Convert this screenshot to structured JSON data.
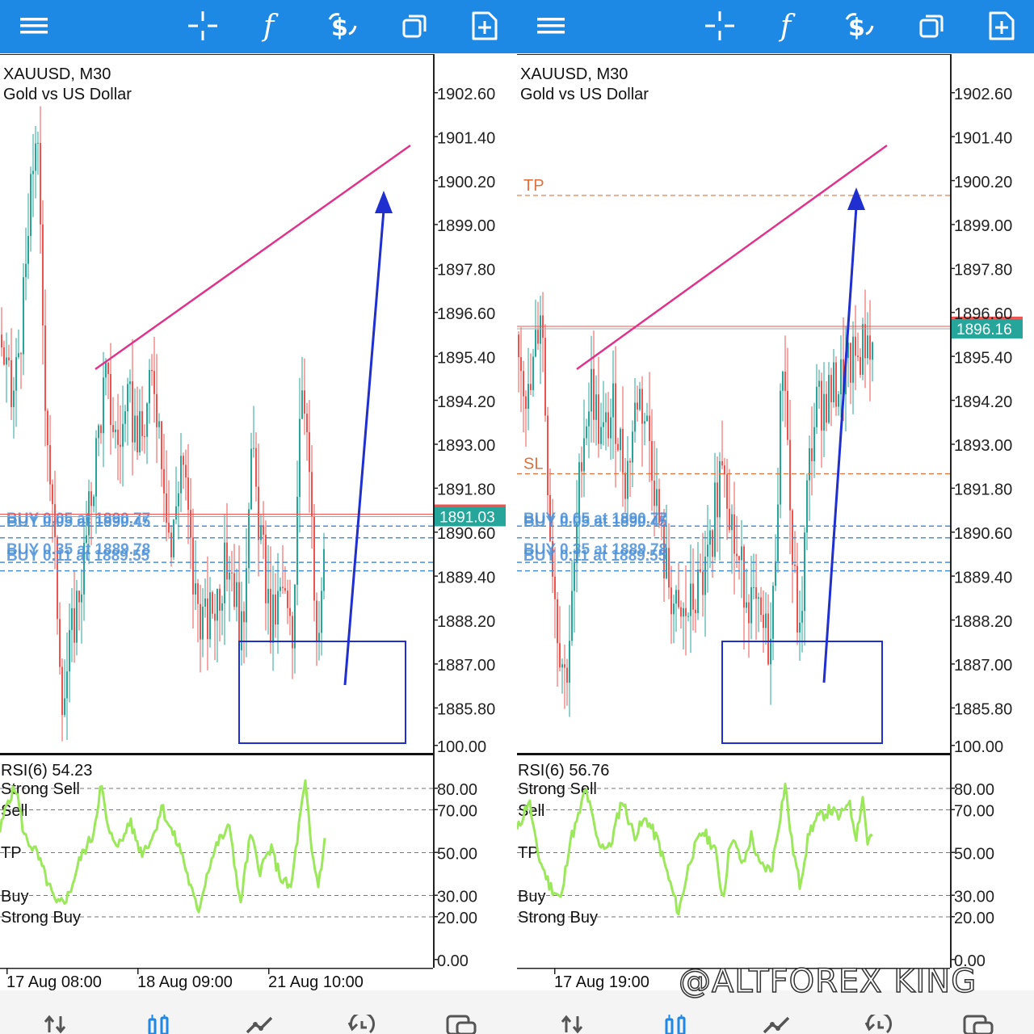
{
  "colors": {
    "toolbar": "#1e88e5",
    "bull": "#26a69a",
    "bear": "#ef5350",
    "trendline": "#e0338c",
    "arrow": "#1f2fd0",
    "rsi": "#9be85b",
    "buy_order": "#4a90d9",
    "tp_sl": "#e2703a",
    "price_tag_left": "#26a69a",
    "price_tag_right": "#26a69a"
  },
  "toolbar": {
    "icons": [
      "menu-icon",
      "crosshair-icon",
      "indicators-icon",
      "trade-icon",
      "windows-icon",
      "new-order-icon"
    ]
  },
  "bottom_nav": {
    "icons": [
      "quotes-icon",
      "chart-icon",
      "trade-icon",
      "history-icon",
      "messages-icon"
    ]
  },
  "panels": [
    {
      "symbol": "XAUUSD, M30",
      "description": "Gold vs US Dollar",
      "price_labels": [
        "1902.60",
        "1901.40",
        "1900.20",
        "1899.00",
        "1897.80",
        "1896.60",
        "1895.40",
        "1894.20",
        "1893.00",
        "1891.80",
        "1890.60",
        "1889.40",
        "1888.20",
        "1887.00",
        "1885.80"
      ],
      "current_price": "1891.03",
      "order_labels": [
        "BUY 0.05 at 1890.77",
        "BUY 0.05 at 1890.45",
        "BUY 0.35 at 1889.78",
        "BUY 0.11 at 1889.55"
      ],
      "tp_label": "",
      "sl_label": "",
      "rsi_title": "RSI(6) 54.23",
      "rsi_levels": {
        "strong_sell": "Strong Sell",
        "sell": "Sell",
        "tp": "TP",
        "buy": "Buy",
        "strong_buy": "Strong Buy"
      },
      "rsi_scale": [
        "100.00",
        "80.00",
        "70.00",
        "50.00",
        "30.00",
        "20.00",
        "0.00"
      ],
      "time_labels": [
        "17 Aug 08:00",
        "18 Aug 09:00",
        "21 Aug 10:00"
      ]
    },
    {
      "symbol": "XAUUSD, M30",
      "description": "Gold vs US Dollar",
      "price_labels": [
        "1902.60",
        "1901.40",
        "1900.20",
        "1899.00",
        "1897.80",
        "1896.60",
        "1895.40",
        "1894.20",
        "1893.00",
        "1891.80",
        "1890.60",
        "1889.40",
        "1888.20",
        "1887.00",
        "1885.80"
      ],
      "current_price": "1896.16",
      "order_labels": [
        "BUY 0.05 at 1890.77",
        "BUY 0.05 at 1890.45",
        "BUY 0.35 at 1889.78",
        "BUY 0.11 at 1889.55"
      ],
      "tp_label": "TP",
      "sl_label": "SL",
      "rsi_title": "RSI(6) 56.76",
      "rsi_levels": {
        "strong_sell": "Strong Sell",
        "sell": "Sell",
        "tp": "TP",
        "buy": "Buy",
        "strong_buy": "Strong Buy"
      },
      "rsi_scale": [
        "100.00",
        "80.00",
        "70.00",
        "50.00",
        "30.00",
        "20.00",
        "0.00"
      ],
      "time_labels": [
        "17 Aug 19:00"
      ]
    }
  ],
  "watermark": "@ALTFOREX KING"
}
